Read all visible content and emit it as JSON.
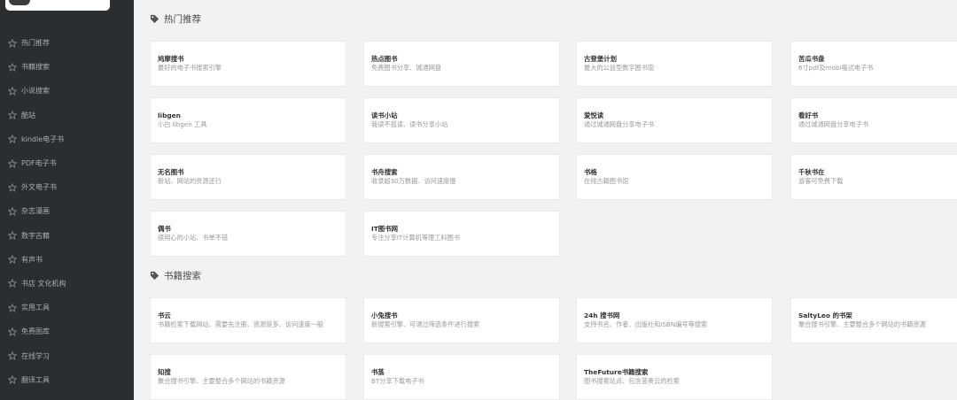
{
  "sidebar": {
    "items": [
      {
        "label": "热门推荐"
      },
      {
        "label": "书籍搜索"
      },
      {
        "label": "小说搜索"
      },
      {
        "label": "酷站"
      },
      {
        "label": "kindle电子书"
      },
      {
        "label": "PDF电子书"
      },
      {
        "label": "外文电子书"
      },
      {
        "label": "杂志漫画"
      },
      {
        "label": "数字古籍"
      },
      {
        "label": "有声书"
      },
      {
        "label": "书店 文化机构"
      },
      {
        "label": "实用工具"
      },
      {
        "label": "免费图库"
      },
      {
        "label": "在线学习"
      },
      {
        "label": "翻译工具"
      }
    ]
  },
  "sections": [
    {
      "title": "热门推荐",
      "cards": [
        {
          "title": "鸠摩搜书",
          "desc": "最好的电子书搜索引擎"
        },
        {
          "title": "热点图书",
          "desc": "免费图书分享、城通网盘"
        },
        {
          "title": "古登堡计划",
          "desc": "最大的公益型数字图书馆"
        },
        {
          "title": "苦瓜书盘",
          "desc": "6寸pdf及mobi格式电子书"
        },
        {
          "title": "libgen",
          "desc": "小白 libgen 工具"
        },
        {
          "title": "读书小站",
          "desc": "我读不孤读、读书分享小站"
        },
        {
          "title": "爱悦读",
          "desc": "通过城通网盘分享电子书"
        },
        {
          "title": "看好书",
          "desc": "通过城通网盘分享电子书"
        },
        {
          "title": "无名图书",
          "desc": "新站、网站的资源还行"
        },
        {
          "title": "书舟搜索",
          "desc": "收录超30万数据、访问速度慢"
        },
        {
          "title": "书格",
          "desc": "在线古籍图书馆"
        },
        {
          "title": "千秋书在",
          "desc": "游客可免费下载"
        },
        {
          "title": "偶书",
          "desc": "很用心的小站、书单不错"
        },
        {
          "title": "IT图书网",
          "desc": "专注分享IT计算机等理工科图书"
        }
      ]
    },
    {
      "title": "书籍搜索",
      "cards": [
        {
          "title": "书云",
          "desc": "书籍检索下载网站、需要先注册、资源挺多、访问速度一般"
        },
        {
          "title": "小兔搜书",
          "desc": "新搜索引擎、可通过筛选条件进行搜索"
        },
        {
          "title": "24h 搜书网",
          "desc": "支持书名、作者、出版社和ISBN编号等搜索"
        },
        {
          "title": "SaltyLeo 的书架",
          "desc": "聚合搜书引擎、主要整合多个网站的书籍资源"
        },
        {
          "title": "知搜",
          "desc": "聚合搜书引擎、主要整合多个网站的书籍资源"
        },
        {
          "title": "书蒸",
          "desc": "BT分享下载电子书"
        },
        {
          "title": "TheFuture书籍搜索",
          "desc": "图书搜索站点、包含蓝奏云的检索"
        }
      ]
    }
  ],
  "colors": {
    "sidebar_bg": "#2b2e31",
    "page_bg": "#f1f2f3",
    "card_bg": "#ffffff"
  },
  "icons": {
    "nav": "star-icon",
    "section": "tag-icon"
  }
}
